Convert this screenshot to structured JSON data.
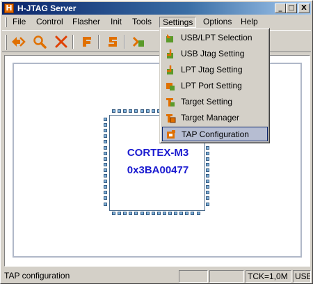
{
  "window": {
    "title": "H-JTAG Server",
    "icon_letter": "H"
  },
  "caption_buttons": {
    "minimize": "_",
    "maximize": "□",
    "close": "X"
  },
  "menu": [
    "File",
    "Control",
    "Flasher",
    "Init",
    "Tools",
    "Settings",
    "Options",
    "Help"
  ],
  "open_menu": "Settings",
  "toolbar": {
    "buttons": [
      {
        "name": "detect-target-icon",
        "color": "#e07000"
      },
      {
        "name": "search-icon",
        "color": "#e07000"
      },
      {
        "name": "stop-icon",
        "color": "#e04000"
      },
      {
        "name": "flasher-icon",
        "color": "#e07000"
      },
      {
        "name": "script-icon",
        "color": "#e07000"
      },
      {
        "name": "tools-icon",
        "color": "#e07000"
      }
    ]
  },
  "settings_menu": {
    "items": [
      {
        "label": "USB/LPT Selection",
        "icon": "usb-lpt-selection-icon"
      },
      {
        "label": "USB Jtag Setting",
        "icon": "usb-jtag-icon"
      },
      {
        "label": "LPT Jtag Setting",
        "icon": "lpt-jtag-icon"
      },
      {
        "label": "LPT Port Setting",
        "icon": "lpt-port-icon"
      },
      {
        "label": "Target Setting",
        "icon": "target-setting-icon"
      },
      {
        "label": "Target Manager",
        "icon": "target-manager-icon"
      },
      {
        "label": "TAP Configuration",
        "icon": "tap-configuration-icon"
      }
    ],
    "selected_index": 6
  },
  "chip": {
    "name": "CORTEX-M3",
    "id": "0x3BA00477",
    "text_color": "#1a1ad0"
  },
  "status": {
    "message": "TAP configuration",
    "pane2": "",
    "pane3": "",
    "clock": "TCK=1,0M",
    "interface": "USB"
  }
}
